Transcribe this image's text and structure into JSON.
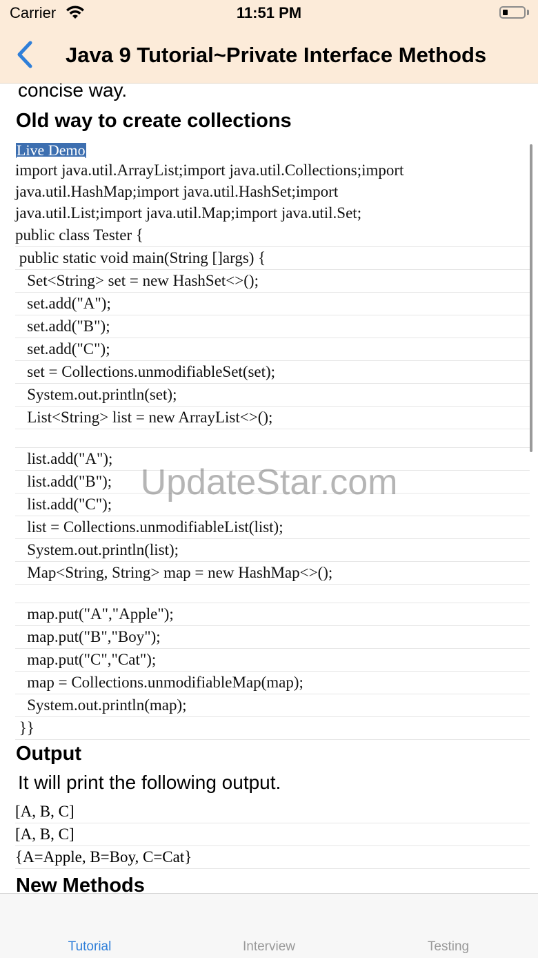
{
  "status_bar": {
    "carrier": "Carrier",
    "time": "11:51 PM"
  },
  "nav": {
    "title": "Java 9 Tutorial~Private Interface Methods"
  },
  "content": {
    "intro_tail": "concise way.",
    "heading_old": "Old way to create collections",
    "live_demo": "Live Demo",
    "import_lines": [
      "import java.util.ArrayList;import java.util.Collections;import",
      "java.util.HashMap;import java.util.HashSet;import",
      "java.util.List;import java.util.Map;import java.util.Set;"
    ],
    "code_lines": [
      "public class Tester {",
      " public static void main(String []args) {",
      "   Set<String> set = new HashSet<>();",
      "   set.add(\"A\");",
      "   set.add(\"B\");",
      "   set.add(\"C\");",
      "   set = Collections.unmodifiableSet(set);",
      "   System.out.println(set);",
      "   List<String> list = new ArrayList<>();",
      "",
      "   list.add(\"A\");",
      "   list.add(\"B\");",
      "   list.add(\"C\");",
      "   list = Collections.unmodifiableList(list);",
      "   System.out.println(list);",
      "   Map<String, String> map = new HashMap<>();",
      "",
      "   map.put(\"A\",\"Apple\");",
      "   map.put(\"B\",\"Boy\");",
      "   map.put(\"C\",\"Cat\");",
      "   map = Collections.unmodifiableMap(map);",
      "   System.out.println(map);",
      " }}"
    ],
    "heading_output": "Output",
    "output_intro": "It will print the following output.",
    "output_lines": [
      "[A, B, C]",
      "[A, B, C]",
      "{A=Apple, B=Boy, C=Cat}"
    ],
    "heading_new": "New Methods"
  },
  "watermark": "UpdateStar.com",
  "tabs": [
    {
      "label": "Tutorial",
      "active": true
    },
    {
      "label": "Interview",
      "active": false
    },
    {
      "label": "Testing",
      "active": false
    }
  ],
  "colors": {
    "nav_background": "#fcebd9",
    "accent": "#2f7fd9",
    "link_highlight": "#3d6fb0"
  }
}
